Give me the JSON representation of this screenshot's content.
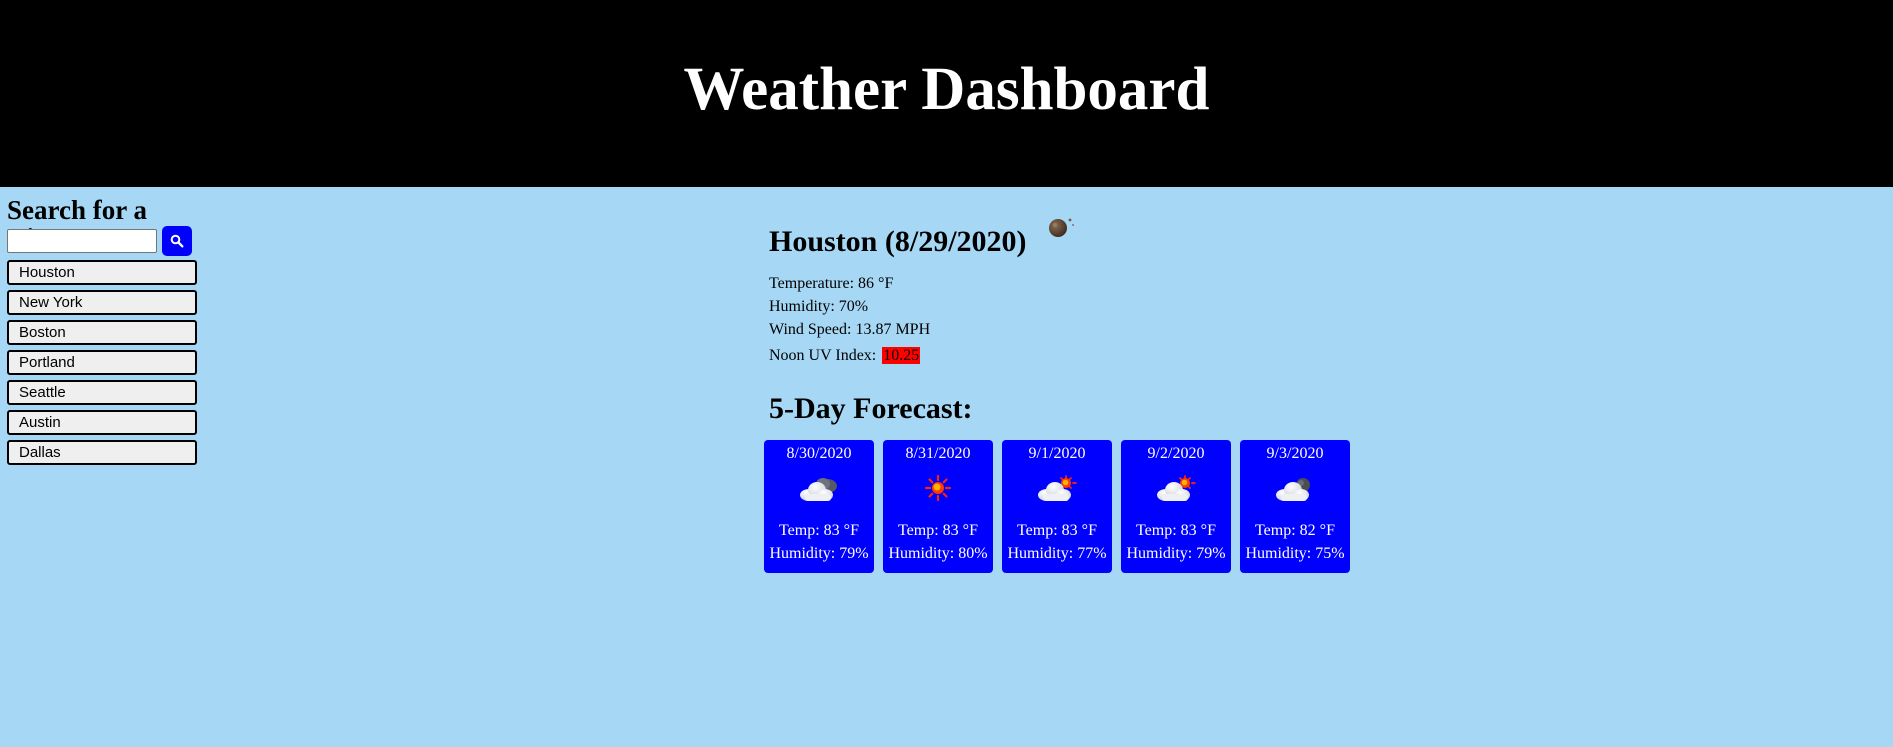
{
  "header": {
    "title": "Weather Dashboard"
  },
  "sidebar": {
    "title": "Search for a City:",
    "search": {
      "value": "",
      "placeholder": "",
      "icon": "search-icon"
    },
    "cities": [
      {
        "label": "Houston"
      },
      {
        "label": "New York"
      },
      {
        "label": "Boston"
      },
      {
        "label": "Portland"
      },
      {
        "label": "Seattle"
      },
      {
        "label": "Austin"
      },
      {
        "label": "Dallas"
      }
    ]
  },
  "current": {
    "title": "Houston (8/29/2020)",
    "icon": "clear-night-icon",
    "temperature": "Temperature: 86 °F",
    "humidity": "Humidity: 70%",
    "wind": "Wind Speed: 13.87 MPH",
    "uv_label": "Noon UV Index:",
    "uv_value": "10.25",
    "uv_color": "#ff0000"
  },
  "forecast": {
    "title": "5-Day Forecast:",
    "days": [
      {
        "date": "8/30/2020",
        "icon": "partly-cloudy-night-icon",
        "temp": "Temp: 83 °F",
        "humidity": "Humidity: 79%"
      },
      {
        "date": "8/31/2020",
        "icon": "sun-icon",
        "temp": "Temp: 83 °F",
        "humidity": "Humidity: 80%"
      },
      {
        "date": "9/1/2020",
        "icon": "partly-cloudy-day-icon",
        "temp": "Temp: 83 °F",
        "humidity": "Humidity: 77%"
      },
      {
        "date": "9/2/2020",
        "icon": "partly-cloudy-day-icon",
        "temp": "Temp: 83 °F",
        "humidity": "Humidity: 79%"
      },
      {
        "date": "9/3/2020",
        "icon": "cloudy-night-icon",
        "temp": "Temp: 82 °F",
        "humidity": "Humidity: 75%"
      }
    ]
  },
  "colors": {
    "page_bg": "#a6d8f5",
    "header_bg": "#000000",
    "card_bg": "#0000ff",
    "button_accent": "#0000ff"
  }
}
